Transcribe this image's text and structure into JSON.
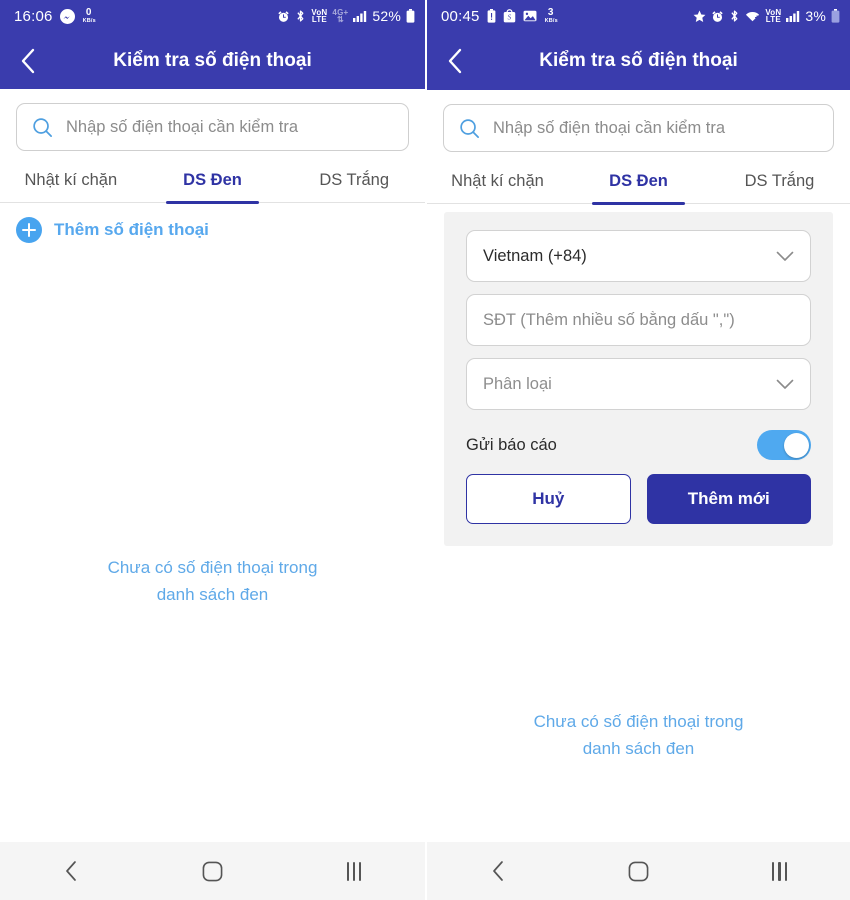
{
  "theme": {
    "header_blue": "#3a3cad",
    "primary_indigo": "#2f33a4",
    "accent_light_blue": "#4fa9f0",
    "empty_text_blue": "#5fa9e8",
    "card_gray": "#f2f2f2",
    "navbar_gray": "#f5f5f5"
  },
  "left": {
    "statusbar": {
      "time": "16:06",
      "net_speed_value": "0",
      "net_speed_unit": "KB/s",
      "left_icons": [
        "messenger-icon",
        "data-speed-indicator"
      ],
      "right_icons": [
        "alarm-icon",
        "bluetooth-icon",
        "volte-icon",
        "4g-plus-icon",
        "signal-bars-icon"
      ],
      "volte_label_top": "VoN",
      "volte_label_bottom": "LTE",
      "network_label": "4G+",
      "battery_percent": "52%"
    },
    "appbar": {
      "title": "Kiểm tra số điện thoại",
      "back_icon": "chevron-left-icon"
    },
    "search": {
      "placeholder": "Nhập số điện thoại cần kiểm tra",
      "value": "",
      "icon": "search-icon"
    },
    "tabs": [
      {
        "label": "Nhật kí chặn",
        "active": false
      },
      {
        "label": "DS Đen",
        "active": true
      },
      {
        "label": "DS Trắng",
        "active": false
      }
    ],
    "add_row": {
      "label": "Thêm số điện thoại",
      "icon": "plus-circle-icon"
    },
    "empty_state": {
      "line1": "Chưa có số điện thoại trong",
      "line2": "danh sách đen"
    },
    "navbar": {
      "back": "nav-back-icon",
      "home": "nav-home-icon",
      "recents": "nav-recents-icon"
    }
  },
  "right": {
    "statusbar": {
      "time": "00:45",
      "net_speed_value": "3",
      "net_speed_unit": "KB/s",
      "left_icons": [
        "battery-saver-icon",
        "shopee-icon",
        "gallery-icon",
        "data-speed-indicator"
      ],
      "right_icons": [
        "star-icon",
        "alarm-icon",
        "bluetooth-icon",
        "wifi-icon",
        "volte-icon",
        "signal-bars-icon"
      ],
      "volte_label_top": "VoN",
      "volte_label_bottom": "LTE",
      "battery_percent": "3%"
    },
    "appbar": {
      "title": "Kiểm tra số điện thoại",
      "back_icon": "chevron-left-icon"
    },
    "search": {
      "placeholder": "Nhập số điện thoại cần kiểm tra",
      "value": "",
      "icon": "search-icon"
    },
    "tabs": [
      {
        "label": "Nhật kí chặn",
        "active": false
      },
      {
        "label": "DS Đen",
        "active": true
      },
      {
        "label": "DS Trắng",
        "active": false
      }
    ],
    "form": {
      "country_select": {
        "value": "Vietnam (+84)",
        "icon": "chevron-down-icon"
      },
      "phone_input": {
        "placeholder": "SĐT (Thêm nhiều số bằng dấu \",\")",
        "value": ""
      },
      "category_select": {
        "value": "Phân loại",
        "icon": "chevron-down-icon"
      },
      "report_toggle": {
        "label": "Gửi báo cáo",
        "state": "on"
      },
      "cancel_button": "Huỷ",
      "submit_button": "Thêm mới"
    },
    "empty_state": {
      "line1": "Chưa có số điện thoại trong",
      "line2": "danh sách đen"
    },
    "navbar": {
      "back": "nav-back-icon",
      "home": "nav-home-icon",
      "recents": "nav-recents-icon"
    }
  }
}
